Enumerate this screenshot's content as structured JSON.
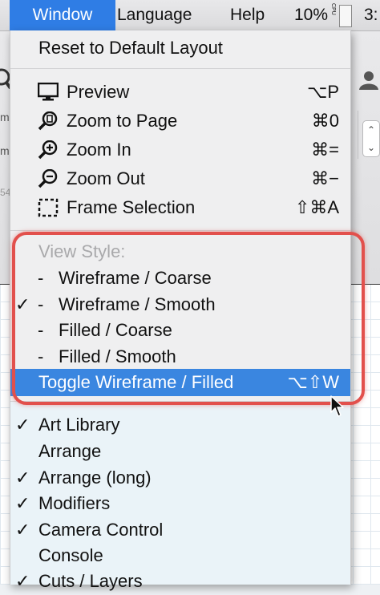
{
  "menubar": {
    "items": [
      "Window",
      "Language",
      "Help"
    ],
    "cpu_percent": "10%",
    "cpu_label": "CPU",
    "truncated": "3:"
  },
  "menu": {
    "reset": "Reset to Default Layout",
    "view": [
      {
        "label": "Preview",
        "shortcut": "⌥P",
        "icon": "monitor-icon"
      },
      {
        "label": "Zoom to Page",
        "shortcut": "⌘0",
        "icon": "zoom-page-icon"
      },
      {
        "label": "Zoom In",
        "shortcut": "⌘=",
        "icon": "zoom-in-icon"
      },
      {
        "label": "Zoom Out",
        "shortcut": "⌘−",
        "icon": "zoom-out-icon"
      },
      {
        "label": "Frame Selection",
        "shortcut": "⇧⌘A",
        "icon": "frame-selection-icon"
      }
    ],
    "view_style_header": "View Style:",
    "view_styles": [
      {
        "label": "Wireframe / Coarse",
        "checked": false
      },
      {
        "label": "Wireframe / Smooth",
        "checked": true
      },
      {
        "label": "Filled / Coarse",
        "checked": false
      },
      {
        "label": "Filled / Smooth",
        "checked": false
      }
    ],
    "dash": "-",
    "toggle": {
      "label": "Toggle Wireframe / Filled",
      "shortcut": "⌥⇧W"
    },
    "panels": [
      {
        "label": "Art Library",
        "checked": true
      },
      {
        "label": "Arrange",
        "checked": false
      },
      {
        "label": "Arrange (long)",
        "checked": true
      },
      {
        "label": "Modifiers",
        "checked": true
      },
      {
        "label": "Camera Control",
        "checked": true
      },
      {
        "label": "Console",
        "checked": false
      },
      {
        "label": "Cuts / Layers",
        "checked": true
      }
    ]
  },
  "background": {
    "trunc_m1": "m",
    "trunc_m2": "m",
    "trunc_54": "54"
  },
  "colors": {
    "highlight": "#3a86e0",
    "callout": "#e2504c",
    "menubar_active": "#2f7de5"
  }
}
